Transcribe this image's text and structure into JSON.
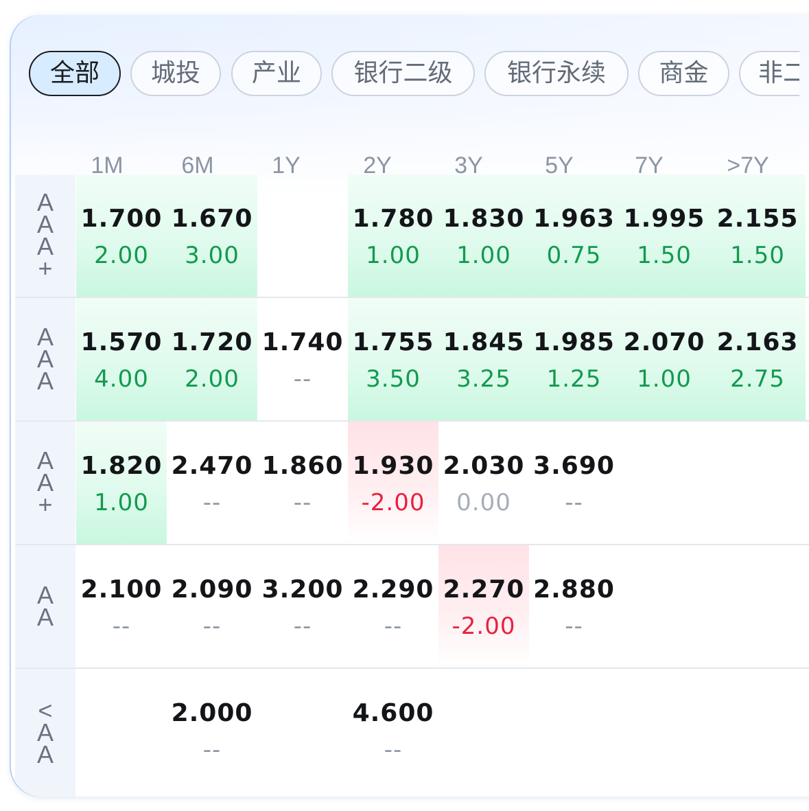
{
  "tabs": [
    {
      "label": "全部",
      "active": true
    },
    {
      "label": "城投",
      "active": false
    },
    {
      "label": "产业",
      "active": false
    },
    {
      "label": "银行二级",
      "active": false
    },
    {
      "label": "银行永续",
      "active": false
    },
    {
      "label": "商金",
      "active": false
    },
    {
      "label": "非二",
      "active": false
    }
  ],
  "columns": [
    "1M",
    "6M",
    "1Y",
    "2Y",
    "3Y",
    "5Y",
    "7Y",
    ">7Y"
  ],
  "rows": [
    {
      "rating": "AAA+",
      "cells": [
        {
          "value": "1.700",
          "change": "2.00",
          "trend": "up"
        },
        {
          "value": "1.670",
          "change": "3.00",
          "trend": "up"
        },
        {
          "value": "",
          "change": "",
          "trend": "none"
        },
        {
          "value": "1.780",
          "change": "1.00",
          "trend": "up"
        },
        {
          "value": "1.830",
          "change": "1.00",
          "trend": "up"
        },
        {
          "value": "1.963",
          "change": "0.75",
          "trend": "up"
        },
        {
          "value": "1.995",
          "change": "1.50",
          "trend": "up"
        },
        {
          "value": "2.155",
          "change": "1.50",
          "trend": "up"
        }
      ]
    },
    {
      "rating": "AAA",
      "cells": [
        {
          "value": "1.570",
          "change": "4.00",
          "trend": "up"
        },
        {
          "value": "1.720",
          "change": "2.00",
          "trend": "up"
        },
        {
          "value": "1.740",
          "change": "--",
          "trend": "none"
        },
        {
          "value": "1.755",
          "change": "3.50",
          "trend": "up"
        },
        {
          "value": "1.845",
          "change": "3.25",
          "trend": "up"
        },
        {
          "value": "1.985",
          "change": "1.25",
          "trend": "up"
        },
        {
          "value": "2.070",
          "change": "1.00",
          "trend": "up"
        },
        {
          "value": "2.163",
          "change": "2.75",
          "trend": "up"
        }
      ]
    },
    {
      "rating": "AA+",
      "cells": [
        {
          "value": "1.820",
          "change": "1.00",
          "trend": "up"
        },
        {
          "value": "2.470",
          "change": "--",
          "trend": "none"
        },
        {
          "value": "1.860",
          "change": "--",
          "trend": "none"
        },
        {
          "value": "1.930",
          "change": "-2.00",
          "trend": "down"
        },
        {
          "value": "2.030",
          "change": "0.00",
          "trend": "zero"
        },
        {
          "value": "3.690",
          "change": "--",
          "trend": "none"
        },
        {
          "value": "",
          "change": "",
          "trend": "none"
        },
        {
          "value": "",
          "change": "",
          "trend": "none"
        }
      ]
    },
    {
      "rating": "AA",
      "cells": [
        {
          "value": "2.100",
          "change": "--",
          "trend": "none"
        },
        {
          "value": "2.090",
          "change": "--",
          "trend": "none"
        },
        {
          "value": "3.200",
          "change": "--",
          "trend": "none"
        },
        {
          "value": "2.290",
          "change": "--",
          "trend": "none"
        },
        {
          "value": "2.270",
          "change": "-2.00",
          "trend": "down"
        },
        {
          "value": "2.880",
          "change": "--",
          "trend": "none"
        },
        {
          "value": "",
          "change": "",
          "trend": "none"
        },
        {
          "value": "",
          "change": "",
          "trend": "none"
        }
      ]
    },
    {
      "rating": "<AA",
      "cells": [
        {
          "value": "",
          "change": "",
          "trend": "none"
        },
        {
          "value": "2.000",
          "change": "--",
          "trend": "none"
        },
        {
          "value": "",
          "change": "",
          "trend": "none"
        },
        {
          "value": "4.600",
          "change": "--",
          "trend": "none"
        },
        {
          "value": "",
          "change": "",
          "trend": "none"
        },
        {
          "value": "",
          "change": "",
          "trend": "none"
        },
        {
          "value": "",
          "change": "",
          "trend": "none"
        },
        {
          "value": "",
          "change": "",
          "trend": "none"
        }
      ]
    }
  ]
}
